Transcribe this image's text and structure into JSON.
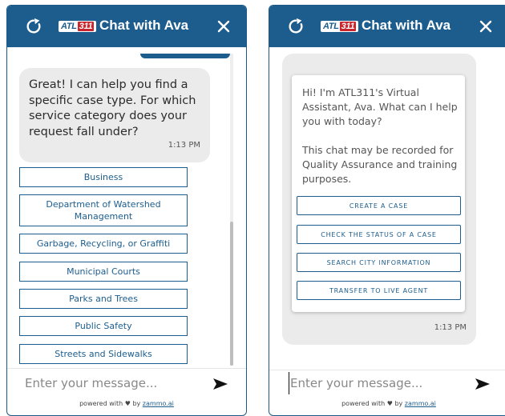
{
  "colors": {
    "header": "#1c5d8e",
    "accent": "#1c5d8e",
    "logo_red": "#c8252c",
    "bubble": "#ebebeb"
  },
  "header": {
    "logo_text_a": "ATL",
    "logo_text_b": "311",
    "title": "Chat with Ava",
    "refresh_icon": "refresh-icon",
    "close_icon": "close-icon"
  },
  "left": {
    "message": "Great! I can help you find a specific case type. For which service category does your request fall under?",
    "time": "1:13 PM",
    "options": [
      "Business",
      "Department of Watershed Management",
      "Garbage, Recycling, or Graffiti",
      "Municipal Courts",
      "Parks and Trees",
      "Public Safety",
      "Streets and Sidewalks"
    ]
  },
  "right": {
    "greeting": "Hi! I'm ATL311's Virtual Assistant, Ava. What can I help you with today?",
    "notice": "This chat may be recorded for Quality Assurance and training purposes.",
    "actions": [
      "CREATE A CASE",
      "CHECK THE STATUS OF A CASE",
      "SEARCH CITY INFORMATION",
      "TRANSFER TO LIVE AGENT"
    ],
    "time": "1:13 PM"
  },
  "input": {
    "placeholder": "Enter your message..."
  },
  "footer": {
    "prefix": "powered with",
    "by": "by",
    "link": "zammo.ai"
  }
}
